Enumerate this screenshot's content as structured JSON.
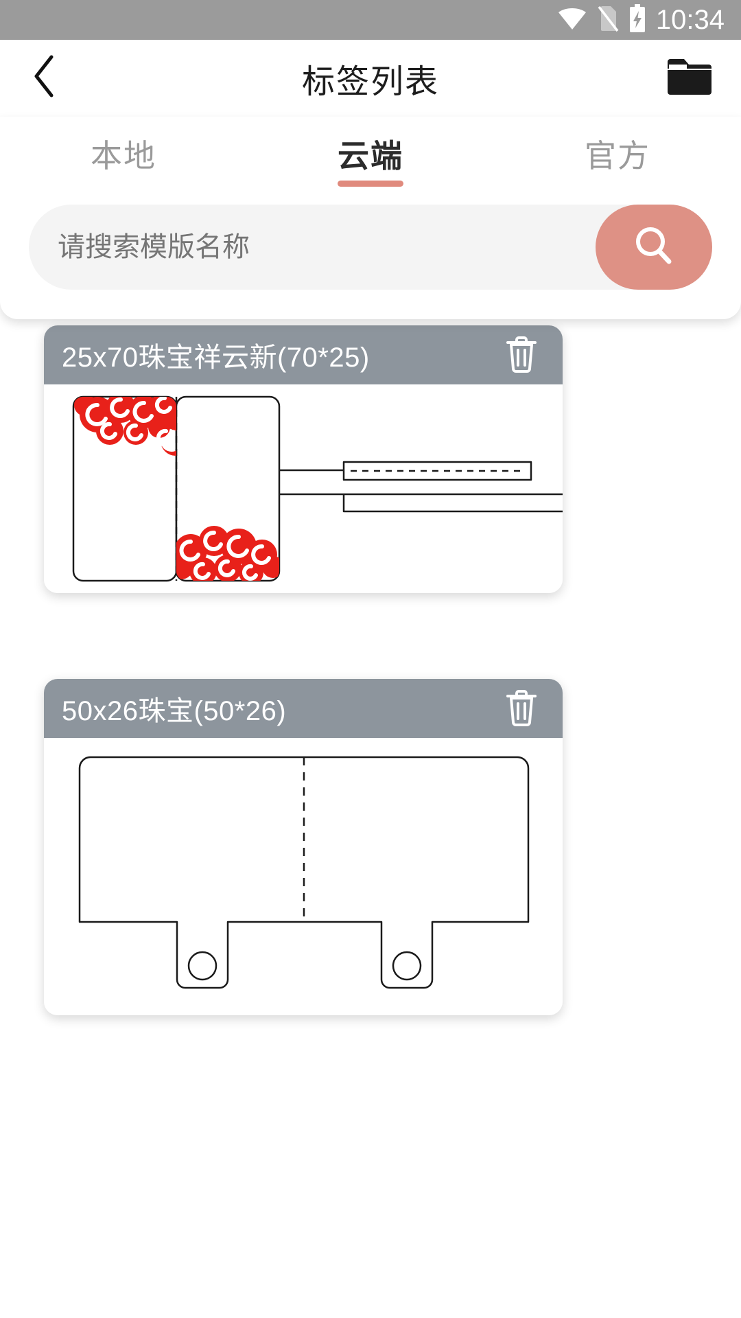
{
  "status_bar": {
    "time": "10:34",
    "icons": [
      "wifi-icon",
      "no-sim-icon",
      "battery-charging-icon"
    ]
  },
  "app_bar": {
    "back_icon": "chevron-left-icon",
    "title": "标签列表",
    "folder_icon": "folder-icon"
  },
  "tabs": {
    "items": [
      {
        "label": "本地",
        "active": false
      },
      {
        "label": "云端",
        "active": true
      },
      {
        "label": "官方",
        "active": false
      }
    ],
    "active_index": 1,
    "active_underline_color": "#e08a7d"
  },
  "search": {
    "value": "",
    "placeholder": "请搜索模版名称",
    "button_icon": "search-icon",
    "button_color": "#de9185",
    "field_color": "#f4f4f4"
  },
  "templates": {
    "header_color": "#8d959d",
    "delete_icon": "trash-icon",
    "items": [
      {
        "name": "25x70珠宝祥云新(70*25)",
        "preview": "jewelry-tag-xiangyun",
        "ornament_color": "#e8211a"
      },
      {
        "name": "50x26珠宝(50*26)",
        "preview": "jewelry-tag-plain",
        "ornament_color": "#000000"
      }
    ]
  }
}
